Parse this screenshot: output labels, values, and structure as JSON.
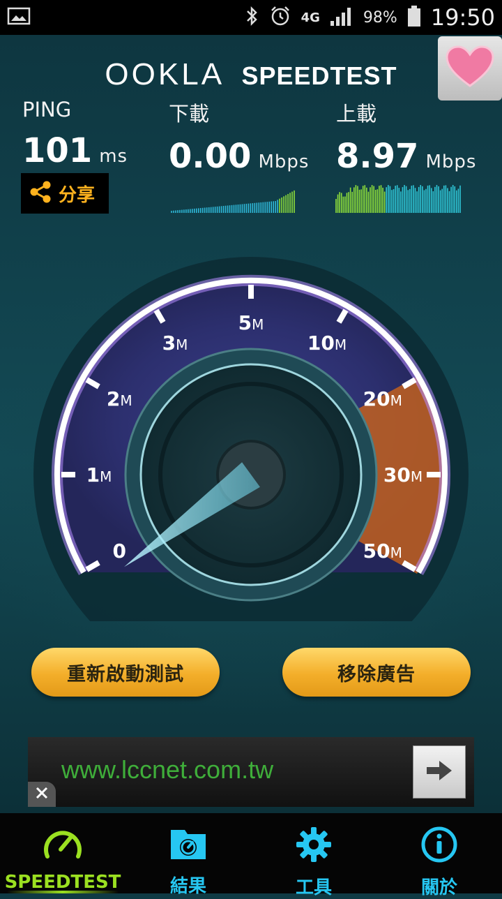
{
  "status_bar": {
    "network": "4G",
    "battery": "98%",
    "time": "19:50",
    "icons": [
      "image-icon",
      "bluetooth-icon",
      "alarm-icon",
      "signal-icon",
      "battery-icon"
    ]
  },
  "header": {
    "logo_ookla": "OOKLA",
    "logo_speedtest": "SPEEDTEST"
  },
  "metrics": {
    "ping": {
      "label": "PING",
      "value": "101",
      "unit": "ms"
    },
    "download": {
      "label": "下載",
      "value": "0.00",
      "unit": "Mbps"
    },
    "upload": {
      "label": "上載",
      "value": "8.97",
      "unit": "Mbps"
    }
  },
  "share": {
    "label": "分享"
  },
  "gauge": {
    "ticks": [
      "0",
      "1",
      "2",
      "3",
      "5",
      "10",
      "20",
      "30",
      "50"
    ],
    "unit_suffix": "M",
    "needle_value": 0
  },
  "buttons": {
    "restart": "重新啟動測試",
    "remove_ads": "移除廣告"
  },
  "ad": {
    "url": "www.lccnet.com.tw"
  },
  "nav": [
    {
      "label": "SPEEDTEST",
      "icon": "speedometer-icon",
      "active": true
    },
    {
      "label": "結果",
      "icon": "results-icon",
      "active": false
    },
    {
      "label": "工具",
      "icon": "gear-icon",
      "active": false
    },
    {
      "label": "關於",
      "icon": "info-icon",
      "active": false
    }
  ],
  "colors": {
    "accent_green": "#9be021",
    "accent_cyan": "#26c7f2",
    "share_orange": "#ffb21e",
    "button_gold": "#f3ae2a"
  }
}
